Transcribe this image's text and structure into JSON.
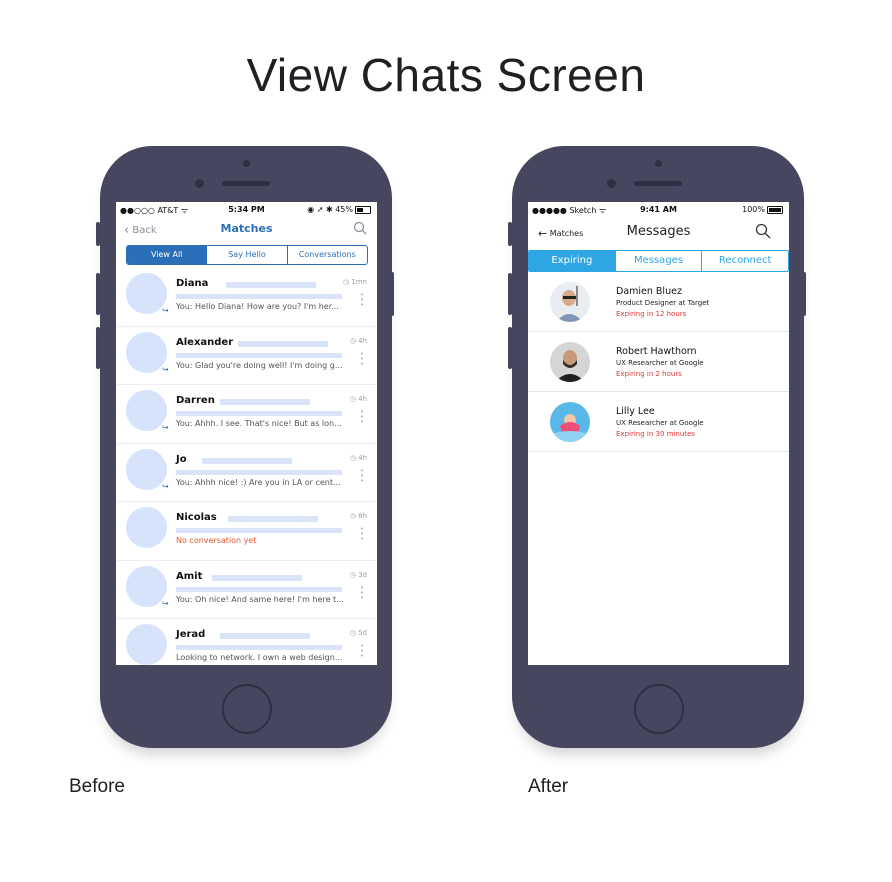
{
  "page_title": "View Chats Screen",
  "captions": {
    "before": "Before",
    "after": "After"
  },
  "before": {
    "status": {
      "left": "●●○○○ AT&T ᯤ",
      "time": "5:34 PM",
      "right": "◉ ➚ ✱ 45%",
      "battery_level": 0.45
    },
    "nav": {
      "back": "Back",
      "title": "Matches"
    },
    "tabs": [
      {
        "label": "View All",
        "active": true
      },
      {
        "label": "Say Hello",
        "active": false
      },
      {
        "label": "Conversations",
        "active": false
      }
    ],
    "chats": [
      {
        "name": "Diana",
        "message": "You: Hello Diana! How are you? I'm her...",
        "time": "1mn",
        "replied": true,
        "no_conv": false
      },
      {
        "name": "Alexander",
        "message": "You: Glad you're doing well! I'm doing g...",
        "time": "4h",
        "replied": true,
        "no_conv": false
      },
      {
        "name": "Darren",
        "message": "You: Ahhh. I see. That's nice! But as lon...",
        "time": "4h",
        "replied": true,
        "no_conv": false
      },
      {
        "name": "Jo",
        "message": "You: Ahhh nice! :) Are you in LA or cent...",
        "time": "4h",
        "replied": true,
        "no_conv": false
      },
      {
        "name": "Nicolas",
        "message": "No conversation yet",
        "time": "8h",
        "replied": false,
        "no_conv": true
      },
      {
        "name": "Amit",
        "message": "You: Oh nice! And same here! I'm here t...",
        "time": "3d",
        "replied": true,
        "no_conv": false
      },
      {
        "name": "Jerad",
        "message": "Looking to network. I own a web design...",
        "time": "5d",
        "replied": false,
        "no_conv": false
      }
    ]
  },
  "after": {
    "status": {
      "left": "●●●●● Sketch ᯤ",
      "time": "9:41 AM",
      "right": "100%",
      "battery_level": 1.0
    },
    "nav": {
      "back": "Matches",
      "title": "Messages"
    },
    "tabs": [
      {
        "label": "Expiring",
        "active": true
      },
      {
        "label": "Messages",
        "active": false
      },
      {
        "label": "Reconnect",
        "active": false
      }
    ],
    "contacts": [
      {
        "name": "Damien Bluez",
        "role": "Product Designer at Target",
        "expiry": "Expiring in 12 hours",
        "avatar_color": "#e9edf2"
      },
      {
        "name": "Robert Hawthorn",
        "role": "UX Researcher at Google",
        "expiry": "Expiring in 2 hours",
        "avatar_color": "#d5d5d5"
      },
      {
        "name": "Lilly Lee",
        "role": "UX Researcher at Google",
        "expiry": "Expiring in 30 minutes",
        "avatar_color": "#59b8e8"
      }
    ]
  },
  "colors": {
    "phone_body": "#47465f",
    "before_accent": "#2a6fb8",
    "after_accent": "#2ea6e6",
    "expiry_red": "#e53935",
    "no_conv_orange": "#e2582b"
  }
}
